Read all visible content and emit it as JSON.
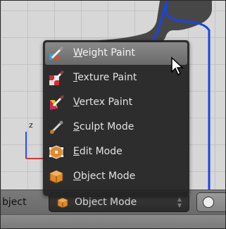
{
  "header": {
    "left_label": "bject",
    "mode_selected": "Object Mode"
  },
  "menu": {
    "items": [
      {
        "mnemonic": "W",
        "rest": "eight Paint",
        "icon": "weight-paint-icon",
        "highlighted": true
      },
      {
        "mnemonic": "T",
        "rest": "exture Paint",
        "icon": "texture-paint-icon",
        "highlighted": false
      },
      {
        "mnemonic": "V",
        "rest": "ertex Paint",
        "icon": "vertex-paint-icon",
        "highlighted": false
      },
      {
        "mnemonic": "S",
        "rest": "culpt Mode",
        "icon": "sculpt-mode-icon",
        "highlighted": false
      },
      {
        "mnemonic": "E",
        "rest": "dit Mode",
        "icon": "edit-mode-icon",
        "highlighted": false
      },
      {
        "mnemonic": "O",
        "rest": "bject Mode",
        "icon": "object-mode-icon",
        "highlighted": false
      }
    ]
  },
  "viewport": {
    "axis_z_label": "z"
  },
  "colors": {
    "menu_bg": "#242424",
    "highlight": "#7a7a7a",
    "axis_z": "#2d4fd6",
    "axis_x": "#d63a3a",
    "mesh_dark": "#474747",
    "mesh_outline": "#1a44e0"
  }
}
